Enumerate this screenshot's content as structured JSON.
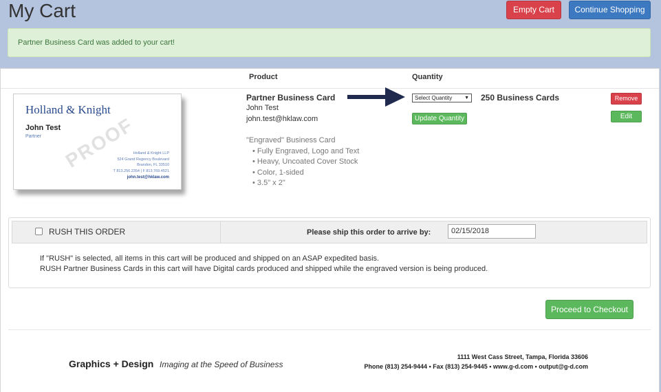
{
  "page": {
    "title": "My Cart"
  },
  "header": {
    "empty_cart_label": "Empty Cart",
    "continue_label": "Continue Shopping"
  },
  "alert": {
    "message": "Partner Business Card was added to your cart!"
  },
  "table": {
    "headers": {
      "product": "Product",
      "quantity": "Quantity"
    }
  },
  "card_image": {
    "logo": "Holland & Knight",
    "name": "John Test",
    "title": "Partner",
    "watermark": "PROOF",
    "address_lines": [
      "Holland & Knight LLP",
      "524 Grand Regency Boulevard",
      "Brandon, FL 33510",
      "T 813.256.2354 | F 813.769.4521"
    ],
    "email": "john.test@hklaw.com"
  },
  "item": {
    "name": "Partner Business Card",
    "person": "John Test",
    "email": "john.test@hklaw.com",
    "desc_title": "\"Engraved\" Business Card",
    "bullets": [
      "• Fully Engraved, Logo and Text",
      "• Heavy, Uncoated Cover Stock",
      "• Color, 1-sided",
      "• 3.5\" x 2\""
    ],
    "qty_select": "Select Quantity",
    "qty_text": "250 Business Cards",
    "update_label": "Update Quantity",
    "remove_label": "Remove",
    "edit_label": "Edit"
  },
  "rush": {
    "label": "RUSH THIS ORDER",
    "checked": false,
    "ship_label": "Please ship this order to arrive by:",
    "date": "02/15/2018",
    "note1": "If \"RUSH\" is selected, all items in this cart will be produced and shipped on an ASAP expedited basis.",
    "note2": "RUSH Partner Business Cards in this cart will have Digital cards produced and shipped while the engraved version is being produced."
  },
  "checkout_label": "Proceed to Checkout",
  "footer": {
    "brand": "Graphics + Design",
    "tagline": "Imaging at the Speed of Business",
    "address": "1111 West Cass Street, Tampa, Florida 33606",
    "contact": "Phone (813) 254-9444 • Fax (813) 254-9445 • www.g-d.com • output@g-d.com"
  },
  "colors": {
    "danger": "#d9414b",
    "primary": "#3c79c0",
    "success": "#5cb85c",
    "arrow": "#1f2a4e",
    "background": "#b4c3de"
  },
  "icons": {
    "arrow": "right-arrow-icon",
    "select_caret": "caret-down-icon"
  }
}
